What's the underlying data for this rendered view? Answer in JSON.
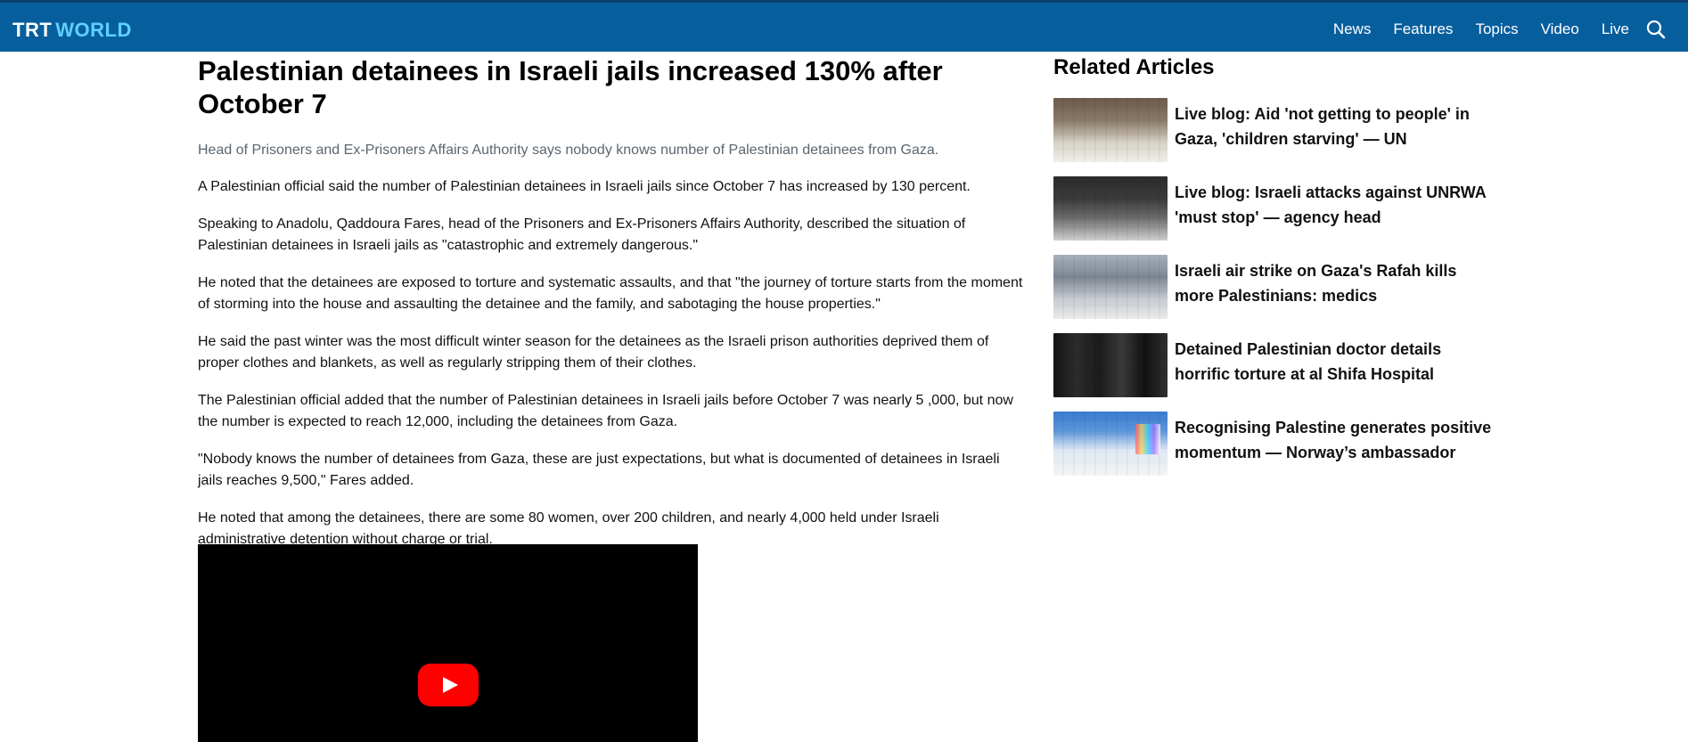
{
  "header": {
    "brand": {
      "trt": "TRT",
      "world": "WORLD"
    },
    "nav": [
      {
        "label": "News"
      },
      {
        "label": "Features"
      },
      {
        "label": "Topics"
      },
      {
        "label": "Video"
      },
      {
        "label": "Live"
      }
    ],
    "search_icon": "search-icon",
    "colors": {
      "bar": "#075e9d",
      "accent": "#5fd0ff"
    }
  },
  "article": {
    "title": "Palestinian detainees in Israeli jails increased 130% after October 7",
    "lede": "Head of Prisoners and Ex-Prisoners Affairs Authority says nobody knows number of Palestinian detainees from Gaza.",
    "paragraphs": [
      "A Palestinian official said the number of Palestinian detainees in Israeli jails since October 7 has increased by 130 percent.",
      "Speaking to Anadolu, Qaddoura Fares, head of the Prisoners and Ex-Prisoners Affairs Authority, described the situation of Palestinian detainees in Israeli jails as \"catastrophic and extremely dangerous.\"",
      "He noted that the detainees are exposed to torture and systematic assaults, and that \"the journey of torture starts from the moment of storming into the house and assaulting the detainee and the family, and sabotaging the house properties.\"",
      "He said the past winter was the most difficult winter season for the detainees as the Israeli prison authorities deprived them of proper clothes and blankets, as well as regularly stripping them of their clothes.",
      "The Palestinian official added that the number of Palestinian detainees in Israeli jails before October 7 was nearly 5 ,000, but now the number is expected to reach 12,000, including the detainees from Gaza.",
      "\"Nobody knows the number of detainees from Gaza, these are just expectations, but what is documented of detainees in Israeli jails reaches 9,500,\" Fares added.",
      "He noted that among the detainees, there are some 80 women, over 200 children, and nearly 4,000 held under Israeli administrative detention without charge or trial."
    ],
    "video": {
      "play_icon": "youtube-play-icon",
      "colors": {
        "background": "#000000",
        "play": "#ff0000"
      }
    }
  },
  "related": {
    "heading": "Related Articles",
    "items": [
      {
        "title": "Live blog: Aid 'not getting to people' in Gaza, 'children starving' — UN"
      },
      {
        "title": "Live blog: Israeli attacks against UNRWA 'must stop' — agency head"
      },
      {
        "title": "Israeli air strike on Gaza's Rafah kills more Palestinians: medics"
      },
      {
        "title": "Detained Palestinian doctor details horrific torture at al Shifa Hospital"
      },
      {
        "title": "Recognising Palestine generates positive momentum — Norway’s ambassador"
      }
    ]
  }
}
